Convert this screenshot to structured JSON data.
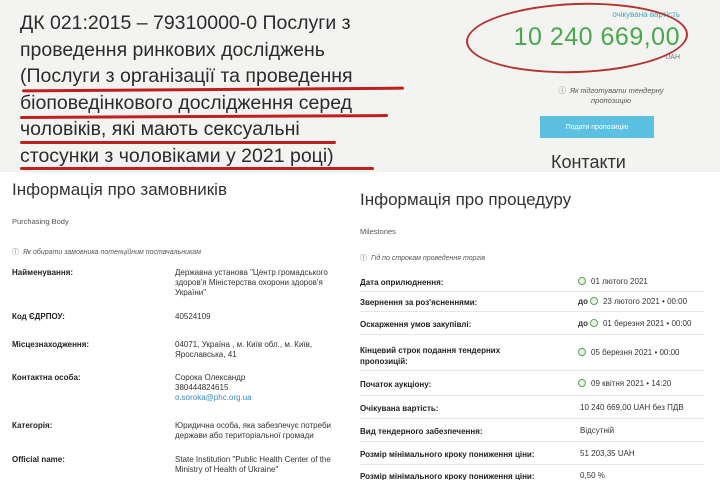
{
  "header": {
    "title_lines": [
      "ДК 021:2015 – 79310000-0 Послуги з",
      "проведення ринкових досліджень",
      "(Послуги з організації та проведення",
      "біоповедінкового дослідження серед",
      "чоловіків, які мають сексуальні",
      "стосунки з чоловіками у 2021 році)"
    ],
    "price_caption": "очікувана вартість",
    "price_value": "10 240 669,00",
    "price_currency": "UAH",
    "howto_text": "Як підготувати тендерну пропозицію",
    "bid_button": "Подати пропозицію",
    "contacts_title": "Контакти",
    "highlight_color": "#c0201d"
  },
  "customer": {
    "title": "Інформація про замовників",
    "subtitle": "Purchasing Body",
    "link": "Як обирати замовника потенційним постачальникам",
    "rows": [
      {
        "label": "Найменування:",
        "value": [
          "Державна установа \"Центр громадського",
          "здоров'я Міністерства охорони здоров'я",
          "України\""
        ]
      },
      {
        "label": "Код ЄДРПОУ:",
        "value": [
          "40524109"
        ]
      },
      {
        "label": "Місцезнаходження:",
        "value": [
          "04071, Україна , м. Київ обл., м. Київ,",
          "Ярославська, 41"
        ]
      },
      {
        "label": "Контактна особа:",
        "value": [
          "Сорока Олександр",
          "380444824615"
        ],
        "email": "o.soroka@phc.org.ua"
      },
      {
        "label": "Категорія:",
        "value": [
          "Юридична особа, яка забезпечує потреби",
          "держави або територіальної громади"
        ]
      },
      {
        "label": "Official name:",
        "value": [
          "State Institution \"Public Health Center of the",
          "Ministry of Health of Ukraine\""
        ]
      }
    ]
  },
  "procedure": {
    "title": "Інформація про процедуру",
    "subtitle": "Milestones",
    "link": "Гід по строкам проведення торгів",
    "rows": [
      {
        "label": "Дата оприлюднення:",
        "prefix": "",
        "value": "01 лютого 2021",
        "clock": true
      },
      {
        "label": "Звернення за роз'ясненнями:",
        "prefix": "до",
        "value": "23 лютого 2021  •  00:00",
        "clock": true
      },
      {
        "label": "Оскарження умов закупівлі:",
        "prefix": "до",
        "value": "01 березня 2021  •  00:00",
        "clock": true
      },
      {
        "label": "Кінцевий строк подання тендерних пропозицій:",
        "prefix": "",
        "value": "05 березня 2021  •  00:00",
        "clock": true
      },
      {
        "label": "Початок аукціону:",
        "prefix": "",
        "value": "09 квітня 2021  •  14:20",
        "clock": true
      },
      {
        "label": "Очікувана вартість:",
        "prefix": "",
        "value": "10 240 669,00 UAH без ПДВ",
        "clock": false
      },
      {
        "label": "Вид тендерного забезпечення:",
        "prefix": "",
        "value": "Відсутній",
        "clock": false
      },
      {
        "label": "Розмір мінімального кроку пониження ціни:",
        "prefix": "",
        "value": "51 203,35 UAH",
        "clock": false
      },
      {
        "label": "Розмір мінімального кроку пониження ціни:",
        "prefix": "",
        "value": "0,50 %",
        "clock": false
      }
    ]
  }
}
